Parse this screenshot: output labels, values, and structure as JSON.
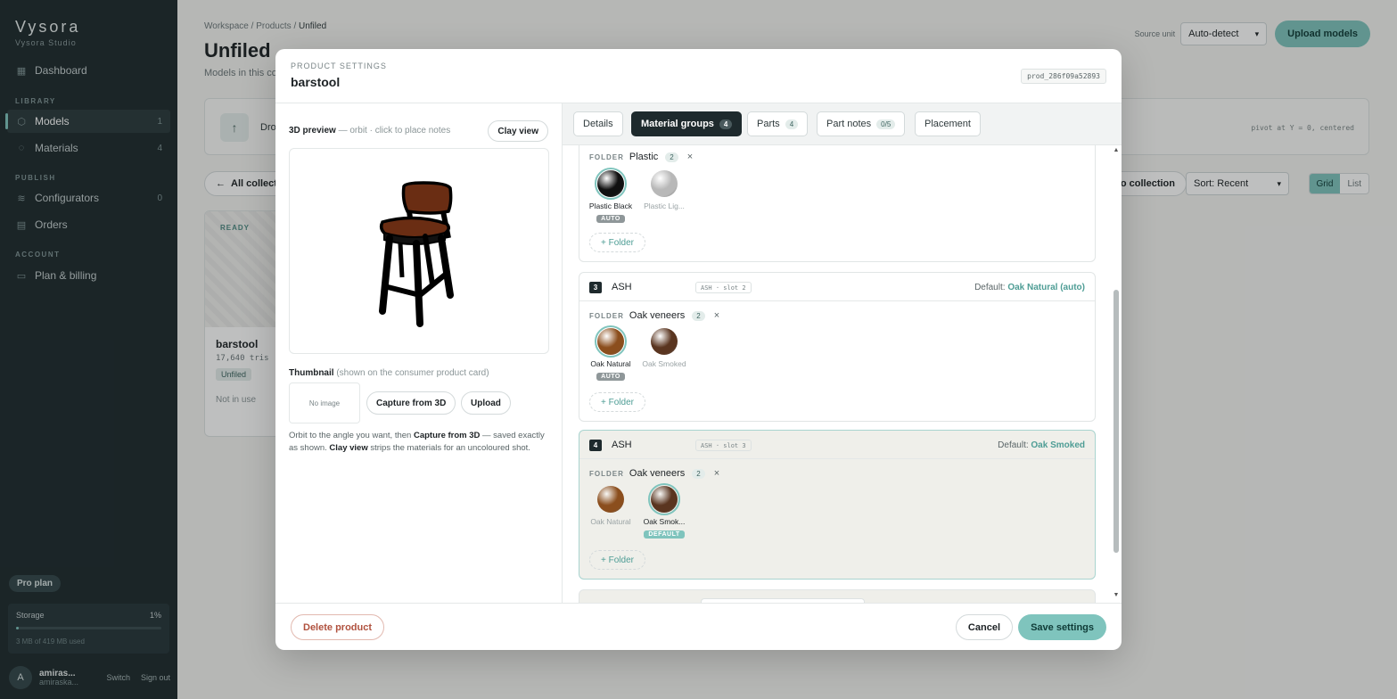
{
  "sidebar": {
    "brand": "Vysora",
    "brand_sub": "Vysora Studio",
    "dashboard": "Dashboard",
    "section_library": "LIBRARY",
    "models": {
      "label": "Models",
      "count": "1"
    },
    "materials": {
      "label": "Materials",
      "count": "4"
    },
    "section_publish": "PUBLISH",
    "configurators": {
      "label": "Configurators",
      "count": "0"
    },
    "orders": "Orders",
    "section_account": "ACCOUNT",
    "billing": "Plan & billing",
    "plan_badge": "Pro plan",
    "storage": {
      "label": "Storage",
      "percent_text": "1%",
      "fraction": 0.01,
      "used_text": "3 MB of 419 MB used"
    },
    "user": {
      "initial": "A",
      "name": "amiras...",
      "email": "amiraska...",
      "switch": "Switch",
      "signout": "Sign out"
    }
  },
  "background": {
    "breadcrumb": {
      "workspace": "Workspace",
      "sep": "/",
      "products": "Products",
      "current": "Unfiled"
    },
    "title": "Unfiled",
    "subtitle": "Models in this co",
    "source_unit_label": "Source unit",
    "source_unit_value": "Auto-detect",
    "upload_btn": "Upload models",
    "drop_text": "Dro",
    "pivot_text": "pivot at Y = 0, centered",
    "all_collections": "All collect",
    "to_collection": "to collection",
    "sort_value": "Sort: Recent",
    "view_grid": "Grid",
    "view_list": "List",
    "card": {
      "status": "READY",
      "name": "barstool",
      "tris": "17,640 tris",
      "badge": "Unfiled",
      "usage": "Not in use"
    }
  },
  "modal": {
    "kicker": "PRODUCT SETTINGS",
    "title": "barstool",
    "product_id": "prod_286f09a52893",
    "preview_title": "3D preview",
    "preview_hint": "— orbit · click to place notes",
    "clay_view": "Clay view",
    "thumbnail_title": "Thumbnail",
    "thumbnail_hint": "(shown on the consumer product card)",
    "no_image": "No image",
    "capture_btn": "Capture from 3D",
    "upload_btn": "Upload",
    "hint_1": "Orbit to the angle you want, then ",
    "hint_b1": "Capture from 3D",
    "hint_2": " — saved exactly as shown. ",
    "hint_b2": "Clay view",
    "hint_3": " strips the materials for an uncoloured shot.",
    "tabs": [
      {
        "label": "Details",
        "count": ""
      },
      {
        "label": "Material groups",
        "count": "4"
      },
      {
        "label": "Parts",
        "count": "4"
      },
      {
        "label": "Part notes",
        "count": "0/5"
      },
      {
        "label": "Placement",
        "count": ""
      }
    ],
    "folder_label": "FOLDER",
    "add_folder": "+ Folder",
    "default_prefix": "Default:",
    "group_top": {
      "folder_name": "Plastic",
      "folder_count": "2",
      "swatches": [
        {
          "label": "Plastic Black",
          "tag": "AUTO",
          "color": "#111111"
        },
        {
          "label": "Plastic Lig...",
          "tag": "",
          "color": "#b8b8b8"
        }
      ]
    },
    "group3": {
      "num": "3",
      "name": "ASH",
      "slot": "ASH · slot 2",
      "default": "Oak Natural (auto)",
      "folder_name": "Oak veneers",
      "folder_count": "2",
      "swatches": [
        {
          "label": "Oak Natural",
          "tag": "AUTO",
          "color": "#8b4e1d"
        },
        {
          "label": "Oak Smoked",
          "tag": "",
          "color": "#5a3520"
        }
      ]
    },
    "group4": {
      "num": "4",
      "name": "ASH",
      "slot": "ASH · slot 3",
      "default": "Oak Smoked",
      "folder_name": "Oak veneers",
      "folder_count": "2",
      "swatches": [
        {
          "label": "Oak Natural",
          "tag": "",
          "color": "#8b4e1d"
        },
        {
          "label": "Oak Smok...",
          "tag": "DEFAULT",
          "color": "#5a3520"
        }
      ]
    },
    "close_glyph": "×",
    "delete_btn": "Delete product",
    "cancel_btn": "Cancel",
    "save_btn": "Save settings"
  },
  "colors": {
    "accent": "#7fc4bd",
    "sidebar_bg": "#1e2a2d",
    "danger": "#b0513e"
  }
}
